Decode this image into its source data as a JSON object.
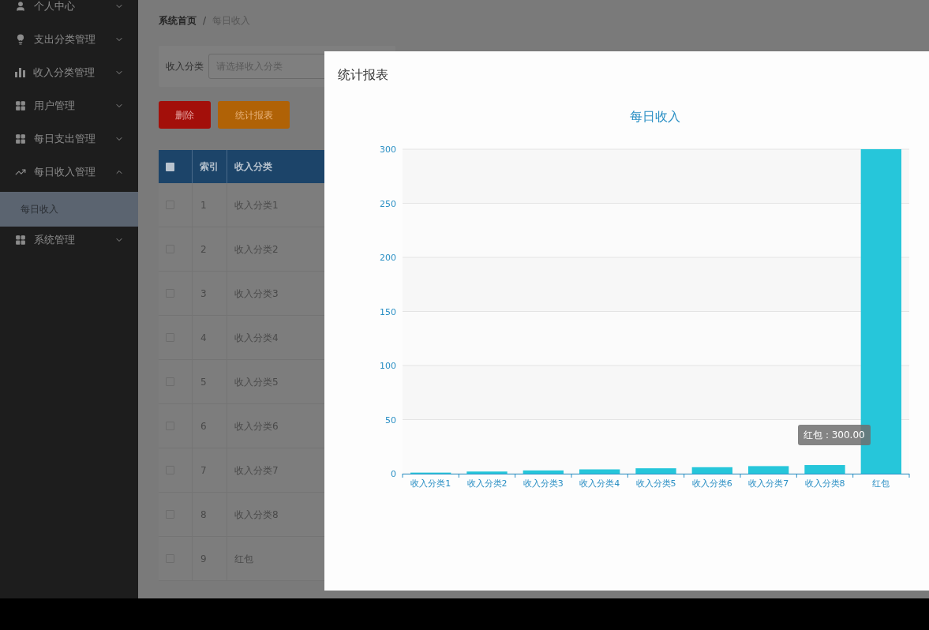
{
  "sidebar": {
    "items": [
      {
        "label": "个人中心",
        "kind": "user",
        "expanded": false
      },
      {
        "label": "支出分类管理",
        "kind": "bulb",
        "expanded": false
      },
      {
        "label": "收入分类管理",
        "kind": "bars",
        "expanded": false
      },
      {
        "label": "用户管理",
        "kind": "grid",
        "expanded": false
      },
      {
        "label": "每日支出管理",
        "kind": "grid",
        "expanded": false
      },
      {
        "label": "每日收入管理",
        "kind": "trend",
        "expanded": true,
        "children": [
          {
            "label": "每日收入",
            "selected": true
          }
        ]
      },
      {
        "label": "系统管理",
        "kind": "grid",
        "expanded": false
      }
    ]
  },
  "breadcrumb": [
    {
      "label": "系统首页",
      "current": false
    },
    {
      "label": "每日收入",
      "current": true
    }
  ],
  "breadcrumb_separator": "/",
  "filter": {
    "label": "收入分类",
    "placeholder": "请选择收入分类"
  },
  "buttons": [
    {
      "label": "删除",
      "kind": "danger"
    },
    {
      "label": "统计报表",
      "kind": "warning"
    }
  ],
  "table": {
    "select_all_checked": false,
    "columns": [
      "索引",
      "收入分类"
    ],
    "rows": [
      {
        "checked": false,
        "cells": [
          "1",
          "收入分类1"
        ]
      },
      {
        "checked": false,
        "cells": [
          "2",
          "收入分类2"
        ]
      },
      {
        "checked": false,
        "cells": [
          "3",
          "收入分类3"
        ]
      },
      {
        "checked": false,
        "cells": [
          "4",
          "收入分类4"
        ]
      },
      {
        "checked": false,
        "cells": [
          "5",
          "收入分类5"
        ]
      },
      {
        "checked": false,
        "cells": [
          "6",
          "收入分类6"
        ]
      },
      {
        "checked": false,
        "cells": [
          "7",
          "收入分类7"
        ]
      },
      {
        "checked": false,
        "cells": [
          "8",
          "收入分类8"
        ]
      },
      {
        "checked": false,
        "cells": [
          "9",
          "红包"
        ]
      }
    ]
  },
  "dialog": {
    "title": "统计报表",
    "chart_data": {
      "type": "bar",
      "title": "每日收入",
      "categories": [
        "收入分类1",
        "收入分类2",
        "收入分类3",
        "收入分类4",
        "收入分类5",
        "收入分类6",
        "收入分类7",
        "收入分类8",
        "红包"
      ],
      "series": [
        {
          "color": "#26c6da",
          "values": [
            1,
            2,
            3,
            4,
            5,
            6,
            7,
            8,
            300
          ]
        }
      ],
      "ylim": [
        0,
        300
      ],
      "yticks": [
        0,
        50,
        100,
        150,
        200,
        250,
        300
      ],
      "grid": true
    },
    "tooltip": {
      "text": "红包：300.00"
    }
  }
}
